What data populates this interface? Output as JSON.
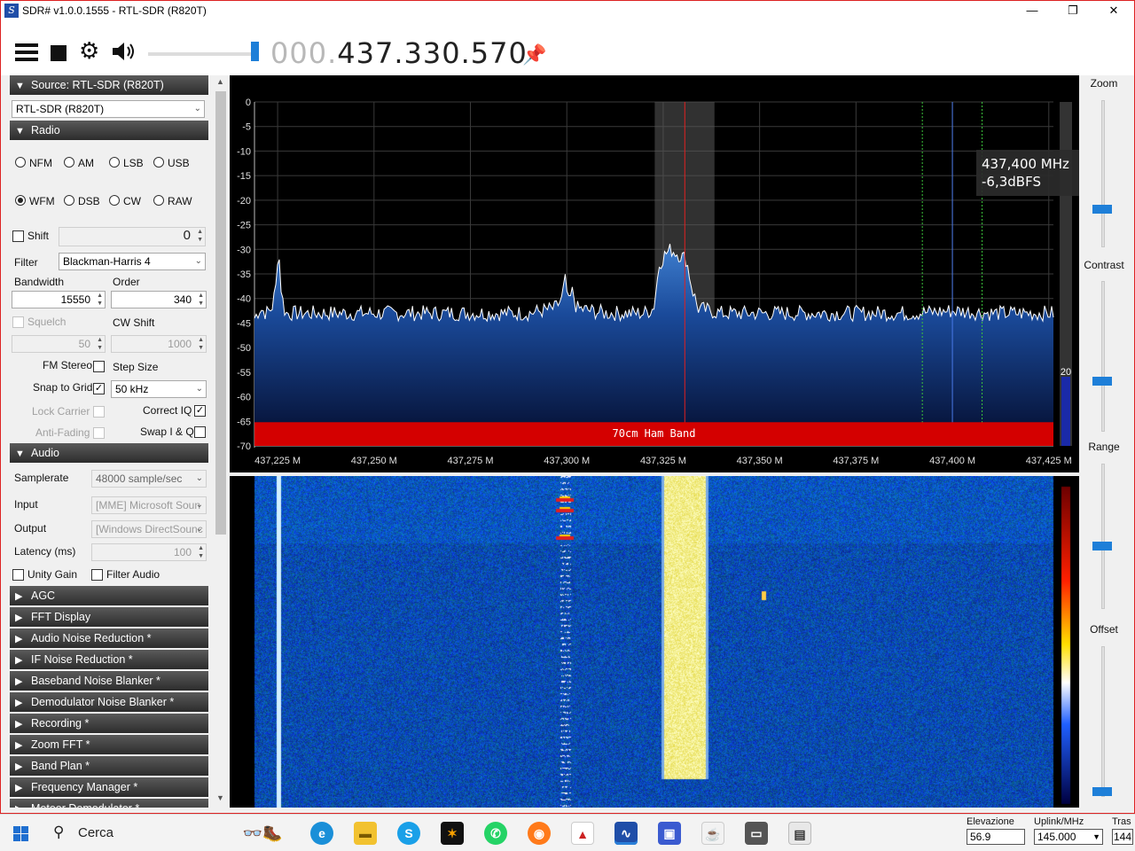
{
  "window": {
    "title": "SDR# v1.0.0.1555 - RTL-SDR (R820T)",
    "minimize": "—",
    "maximize": "❐",
    "close": "✕"
  },
  "toolbar": {
    "freq_prefix": "000.",
    "freq_value": "437.330.570"
  },
  "source": {
    "header": "Source: RTL-SDR (R820T)",
    "device": "RTL-SDR (R820T)"
  },
  "radio": {
    "header": "Radio",
    "modes": [
      "NFM",
      "AM",
      "LSB",
      "USB",
      "WFM",
      "DSB",
      "CW",
      "RAW"
    ],
    "selected_mode": "WFM",
    "shift_label": "Shift",
    "shift_value": "0",
    "filter_label": "Filter",
    "filter_value": "Blackman-Harris 4",
    "bandwidth_label": "Bandwidth",
    "bandwidth_value": "15550",
    "order_label": "Order",
    "order_value": "340",
    "squelch_label": "Squelch",
    "squelch_value": "50",
    "cwshift_label": "CW Shift",
    "cwshift_value": "1000",
    "fmstereo_label": "FM Stereo",
    "stepsize_label": "Step Size",
    "snap_label": "Snap to Grid",
    "step_value": "50 kHz",
    "lockcarrier_label": "Lock Carrier",
    "correctiq_label": "Correct IQ",
    "antifading_label": "Anti-Fading",
    "swapiq_label": "Swap I & Q"
  },
  "audio": {
    "header": "Audio",
    "samplerate_label": "Samplerate",
    "samplerate_value": "48000 sample/sec",
    "input_label": "Input",
    "input_value": "[MME] Microsoft Soun",
    "output_label": "Output",
    "output_value": "[Windows DirectSounc",
    "latency_label": "Latency (ms)",
    "latency_value": "100",
    "unitygain_label": "Unity Gain",
    "filteraudio_label": "Filter Audio"
  },
  "plugins": [
    "AGC",
    "FFT Display",
    "Audio Noise Reduction *",
    "IF Noise Reduction *",
    "Baseband Noise Blanker *",
    "Demodulator Noise Blanker *",
    "Recording *",
    "Zoom FFT *",
    "Band Plan *",
    "Frequency Manager *",
    "Meteor Demodulator *"
  ],
  "right_panel": {
    "zoom_label": "Zoom",
    "contrast_label": "Contrast",
    "range_label": "Range",
    "offset_label": "Offset"
  },
  "chart_data": {
    "type": "line",
    "xlabel": "",
    "ylabel": "",
    "x_ticks": [
      "437,225 M",
      "437,250 M",
      "437,275 M",
      "437,300 M",
      "437,325 M",
      "437,350 M",
      "437,375 M",
      "437,400 M",
      "437,425 M"
    ],
    "x_tick_values": [
      437.225,
      437.25,
      437.275,
      437.3,
      437.325,
      437.35,
      437.375,
      437.4,
      437.425
    ],
    "xlim": [
      437.219,
      437.4262
    ],
    "ylim": [
      -70,
      0
    ],
    "y_ticks": [
      0,
      -5,
      -10,
      -15,
      -20,
      -25,
      -30,
      -35,
      -40,
      -45,
      -50,
      -55,
      -60,
      -65,
      -70
    ],
    "grid": true,
    "series": [
      {
        "values_mhz_dbfs": [
          [
            437.219,
            -44
          ],
          [
            437.2205,
            -42
          ],
          [
            437.222,
            -43
          ],
          [
            437.2235,
            -42
          ],
          [
            437.2245,
            -38
          ],
          [
            437.2252,
            -29
          ],
          [
            437.226,
            -39
          ],
          [
            437.227,
            -43
          ],
          [
            437.23,
            -43
          ],
          [
            437.24,
            -43
          ],
          [
            437.25,
            -43
          ],
          [
            437.26,
            -43
          ],
          [
            437.27,
            -43
          ],
          [
            437.28,
            -43
          ],
          [
            437.29,
            -43
          ],
          [
            437.297,
            -42
          ],
          [
            437.2988,
            -40
          ],
          [
            437.2995,
            -36
          ],
          [
            437.3005,
            -41
          ],
          [
            437.3015,
            -38.5
          ],
          [
            437.3025,
            -42
          ],
          [
            437.31,
            -43
          ],
          [
            437.32,
            -43
          ],
          [
            437.3225,
            -42
          ],
          [
            437.324,
            -33
          ],
          [
            437.3255,
            -31
          ],
          [
            437.327,
            -30
          ],
          [
            437.329,
            -31
          ],
          [
            437.331,
            -32
          ],
          [
            437.3325,
            -38
          ],
          [
            437.334,
            -42
          ],
          [
            437.34,
            -43
          ],
          [
            437.35,
            -43
          ],
          [
            437.36,
            -43
          ],
          [
            437.37,
            -43
          ],
          [
            437.38,
            -43
          ],
          [
            437.39,
            -43
          ],
          [
            437.4,
            -42.5
          ],
          [
            437.41,
            -43
          ],
          [
            437.42,
            -43
          ],
          [
            437.4262,
            -43
          ]
        ]
      }
    ],
    "markers": {
      "center_mhz": 437.3306,
      "filter_band_mhz": [
        437.3228,
        437.3383
      ],
      "cursor_mhz": 437.4,
      "cursor_band_mhz": [
        437.3922,
        437.4077
      ]
    },
    "band_plan": {
      "label": "70cm Ham Band",
      "color": "#d40000"
    },
    "tooltip": {
      "line1": "437,400 MHz",
      "line2": "-6,3dBFS"
    },
    "level_meter_value": "20"
  },
  "taskbar": {
    "search": "Cerca",
    "elevazione_label": "Elevazione",
    "elevazione_value": "56.9",
    "uplink_label": "Uplink/MHz",
    "uplink_value": "145.000",
    "tras_label": "Tras",
    "tras_value": "144"
  },
  "colors": {
    "accent": "#1e7fd8",
    "spectrum_fill_top": "#2f6fbf",
    "spectrum_fill_bottom": "#0a1440",
    "band_red": "#d40000",
    "section_bg": "#3a3a3a"
  }
}
